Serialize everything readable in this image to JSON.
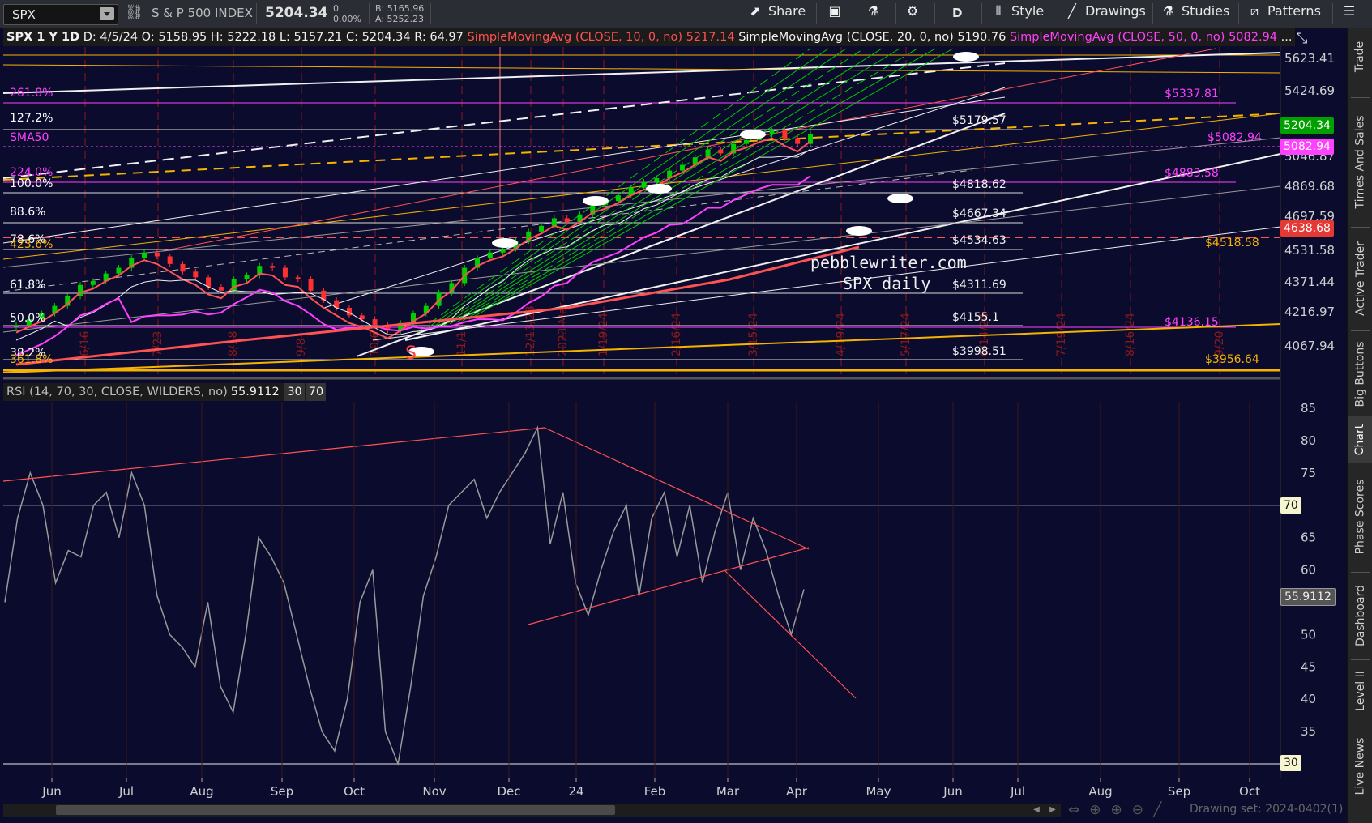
{
  "toolbar": {
    "symbol": "SPX",
    "symbol_name": "S & P 500 INDEX",
    "last_price": "5204.34",
    "net_change": "0",
    "pct_change": "0.00%",
    "bid": "B: 5165.96",
    "ask": "A: 5252.23",
    "share": "Share",
    "period": "D",
    "style": "Style",
    "drawings": "Drawings",
    "studies": "Studies",
    "patterns": "Patterns"
  },
  "infobar": {
    "label": "SPX 1 Y 1D",
    "date": "D: 4/5/24",
    "open": "O: 5158.95",
    "high": "H: 5222.18",
    "low": "L: 5157.21",
    "close": "C: 5204.34",
    "range": "R: 64.97",
    "sma10": "SimpleMovingAvg (CLOSE, 10, 0, no)",
    "sma10_val": "5217.14",
    "sma20": "SimpleMovingAvg (CLOSE, 20, 0, no)",
    "sma20_val": "5190.76",
    "sma50": "SimpleMovingAvg (CLOSE, 50, 0, no)",
    "sma50_val": "5082.94",
    "more": "..."
  },
  "price_axis": [
    "5623.41",
    "5424.69",
    "5046.87",
    "4869.68",
    "4697.59",
    "4531.58",
    "4371.44",
    "4216.97",
    "4067.94"
  ],
  "price_tags": [
    {
      "text": "5204.34",
      "bg": "#00a000",
      "fg": "#ffffff"
    },
    {
      "text": "5082.94",
      "bg": "#ff40ff",
      "fg": "#ffffff"
    },
    {
      "text": "4638.68",
      "bg": "#e53935",
      "fg": "#ffffff"
    }
  ],
  "fib_left": [
    {
      "text": "261.8%",
      "color": "#ff40ff"
    },
    {
      "text": "127.2%",
      "color": "#ffffff"
    },
    {
      "text": "SMA50",
      "color": "#ff40ff"
    },
    {
      "text": "224.0%",
      "color": "#ff40ff"
    },
    {
      "text": "100.0%",
      "color": "#ffffff"
    },
    {
      "text": "88.6%",
      "color": "#ffffff"
    },
    {
      "text": "78.6%",
      "color": "#ffffff"
    },
    {
      "text": "423.6%",
      "color": "#f5b400"
    },
    {
      "text": "61.8%",
      "color": "#ffffff"
    },
    {
      "text": "50.0%",
      "color": "#ffffff"
    },
    {
      "text": "38.2%",
      "color": "#ffffff"
    },
    {
      "text": "361.8%",
      "color": "#f5b400"
    }
  ],
  "levels_white": [
    "$5179.57",
    "$4818.62",
    "$4667.34",
    "$4534.63",
    "$4311.69",
    "$4155.1",
    "$3998.51"
  ],
  "levels_right": [
    {
      "text": "$5337.81",
      "color": "#ff40ff"
    },
    {
      "text": "$5082.94",
      "color": "#ff40ff"
    },
    {
      "text": "$4883.58",
      "color": "#ff40ff"
    },
    {
      "text": "$4518.58",
      "color": "#f5b400"
    },
    {
      "text": "$4136.15",
      "color": "#ff40ff"
    },
    {
      "text": "$3956.64",
      "color": "#f5b400"
    }
  ],
  "watermark": {
    "site": "pebblewriter.com",
    "sub": "SPX daily"
  },
  "cycle_dates": [
    "6/16",
    "7/23",
    "8/18",
    "9/8",
    "10/6",
    "11/1",
    "12/13/23",
    "2023 Mar",
    "1/19/24",
    "2/16/24",
    "3/15/24",
    "4/19/24",
    "5/17/24",
    "6/14/24",
    "7/19/24",
    "8/16/24",
    "9/20"
  ],
  "s_marker": "S",
  "rsi": {
    "label": "RSI (14, 70, 30, CLOSE, WILDERS, no)",
    "value": "55.9112",
    "over": "30",
    "under": "70",
    "axis": [
      "85",
      "80",
      "75",
      "65",
      "60",
      "50",
      "45",
      "40",
      "35"
    ],
    "tag70": "70",
    "tag30": "30",
    "tag_val": "55.9112"
  },
  "time_axis": [
    "Jun",
    "Jul",
    "Aug",
    "Sep",
    "Oct",
    "Nov",
    "Dec",
    "24",
    "Feb",
    "Mar",
    "Apr",
    "May",
    "Jun",
    "Jul",
    "Aug",
    "Sep",
    "Oct"
  ],
  "bottom": {
    "drawing_set": "Drawing set: 2024-0402(1)"
  },
  "side_tabs": [
    "Trade",
    "Times And Sales",
    "Active Trader",
    "Big Buttons",
    "Chart",
    "Phase Scores",
    "Dashboard",
    "Level II",
    "Live News"
  ],
  "colors": {
    "background": "#0b0b2e",
    "sma10": "#ff5252",
    "sma50": "#ff40ff",
    "fib": "#f5b400",
    "channel": "#00c800",
    "grid": "#3a1a1a"
  }
}
